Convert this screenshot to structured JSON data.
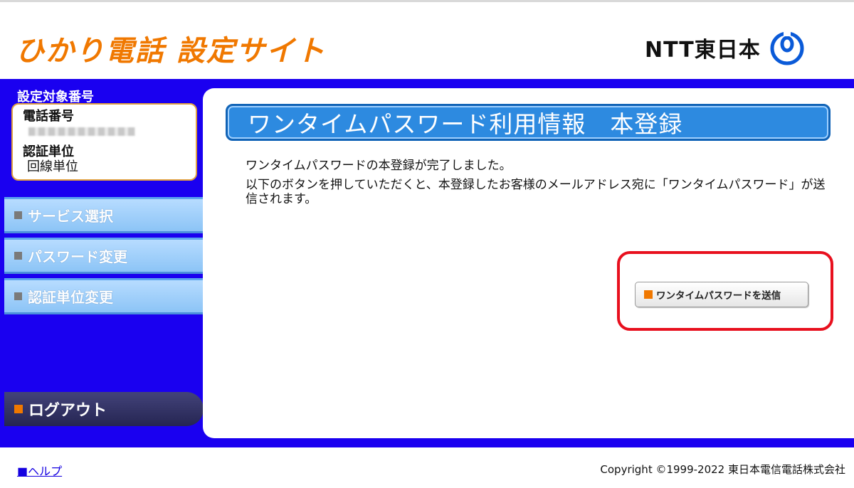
{
  "header": {
    "site_title": "ひかり電話 設定サイト",
    "brand_name": "NTT東日本",
    "brand_color": "#f07800"
  },
  "sidebar": {
    "target_heading": "設定対象番号",
    "phone_label": "電話番号",
    "auth_label": "認証単位",
    "auth_value": "回線単位",
    "nav_items": [
      {
        "label": "サービス選択"
      },
      {
        "label": "パスワード変更"
      },
      {
        "label": "認証単位変更"
      }
    ],
    "logout_label": "ログアウト"
  },
  "main": {
    "page_title": "ワンタイムパスワード利用情報　本登録",
    "message_complete": "ワンタイムパスワードの本登録が完了しました。",
    "message_instruction": "以下のボタンを押していただくと、本登録したお客様のメールアドレス宛に「ワンタイムパスワード」が送信されます。",
    "send_button_label": "ワンタイムパスワードを送信"
  },
  "footer": {
    "help_label": "■ヘルプ",
    "copyright": "Copyright ©1999-2022 東日本電信電話株式会社"
  },
  "colors": {
    "accent_blue": "#1a00f0",
    "highlight_red": "#e8101e",
    "banner_blue": "#2d8ae0"
  },
  "icons": {
    "nav_bullet": "gray-square-icon",
    "button_bullet": "orange-square-icon",
    "brand_mark": "ntt-logo-icon"
  }
}
